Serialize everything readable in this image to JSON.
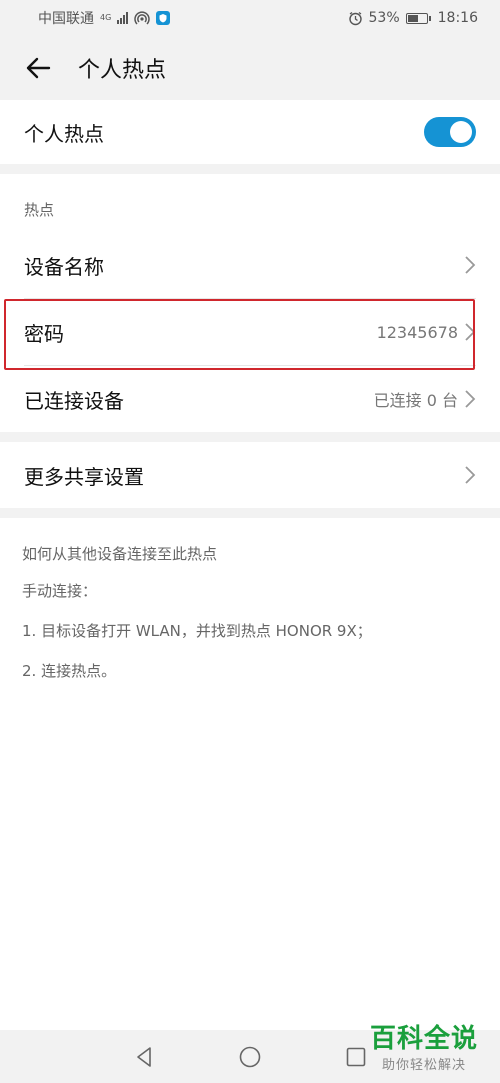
{
  "status_bar": {
    "carrier": "中国联通",
    "network": "4G",
    "battery": "53%",
    "time": "18:16",
    "icons": [
      "signal-icon",
      "hotspot-icon",
      "shield-icon",
      "alarm-icon",
      "battery-icon"
    ]
  },
  "header": {
    "title": "个人热点",
    "back_icon": "arrow-left-icon"
  },
  "hotspot_toggle": {
    "label": "个人热点",
    "enabled": true,
    "accent_color": "#1593d4"
  },
  "hotspot_section": {
    "header": "热点",
    "items": [
      {
        "label": "设备名称",
        "value": "",
        "icon": "chevron-right-icon"
      },
      {
        "label": "密码",
        "value": "12345678",
        "icon": "chevron-right-icon"
      },
      {
        "label": "已连接设备",
        "value": "已连接 0 台",
        "icon": "chevron-right-icon"
      }
    ]
  },
  "more_sharing": {
    "label": "更多共享设置",
    "icon": "chevron-right-icon"
  },
  "help": {
    "title": "如何从其他设备连接至此热点",
    "manual": "手动连接：",
    "step1": "1. 目标设备打开 WLAN，并找到热点 HONOR 9X；",
    "step2": "2. 连接热点。"
  },
  "annotation": {
    "highlight_color": "#d0272d"
  },
  "nav_bar": {
    "icons": [
      "back-triangle-icon",
      "home-circle-icon",
      "recents-square-icon"
    ]
  },
  "watermark": {
    "logo": "百科全说",
    "tagline": "助你轻松解决"
  }
}
